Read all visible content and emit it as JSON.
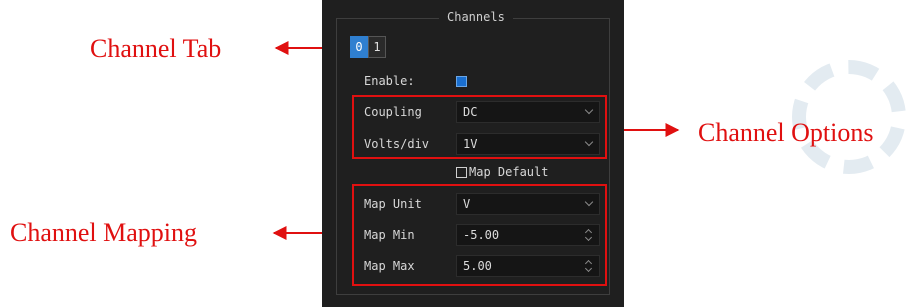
{
  "callouts": {
    "channel_tab": "Channel Tab",
    "channel_options": "Channel Options",
    "channel_mapping": "Channel Mapping"
  },
  "panel": {
    "group_title": "Channels",
    "tabs": [
      {
        "label": "0",
        "active": true
      },
      {
        "label": "1",
        "active": false
      }
    ],
    "enable_label": "Enable:",
    "enable_checked": true,
    "coupling": {
      "label": "Coupling",
      "value": "DC"
    },
    "volts_div": {
      "label": "Volts/div",
      "value": "1V"
    },
    "map_default": {
      "label": "Map Default",
      "checked": false
    },
    "map_unit": {
      "label": "Map Unit",
      "value": "V"
    },
    "map_min": {
      "label": "Map Min",
      "value": "-5.00"
    },
    "map_max": {
      "label": "Map Max",
      "value": "5.00"
    }
  },
  "colors": {
    "accent": "#2f7fd0",
    "annotation": "#e01010",
    "panel_bg": "#1f1f1f"
  }
}
